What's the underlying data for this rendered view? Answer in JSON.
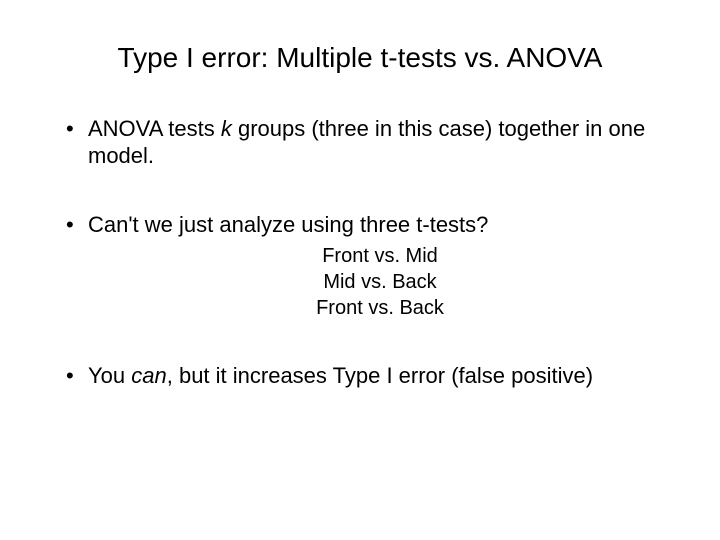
{
  "title": "Type I error: Multiple t-tests vs. ANOVA",
  "bullets": {
    "b1_pre": "ANOVA tests ",
    "b1_ital": "k",
    "b1_post": " groups (three in this case) together in one model.",
    "b2": "Can't we just analyze using three t-tests?",
    "sub1": "Front vs. Mid",
    "sub2": "Mid vs. Back",
    "sub3": "Front vs. Back",
    "b3_pre": "You ",
    "b3_ital": "can",
    "b3_post": ", but it increases Type I error (false positive)"
  }
}
